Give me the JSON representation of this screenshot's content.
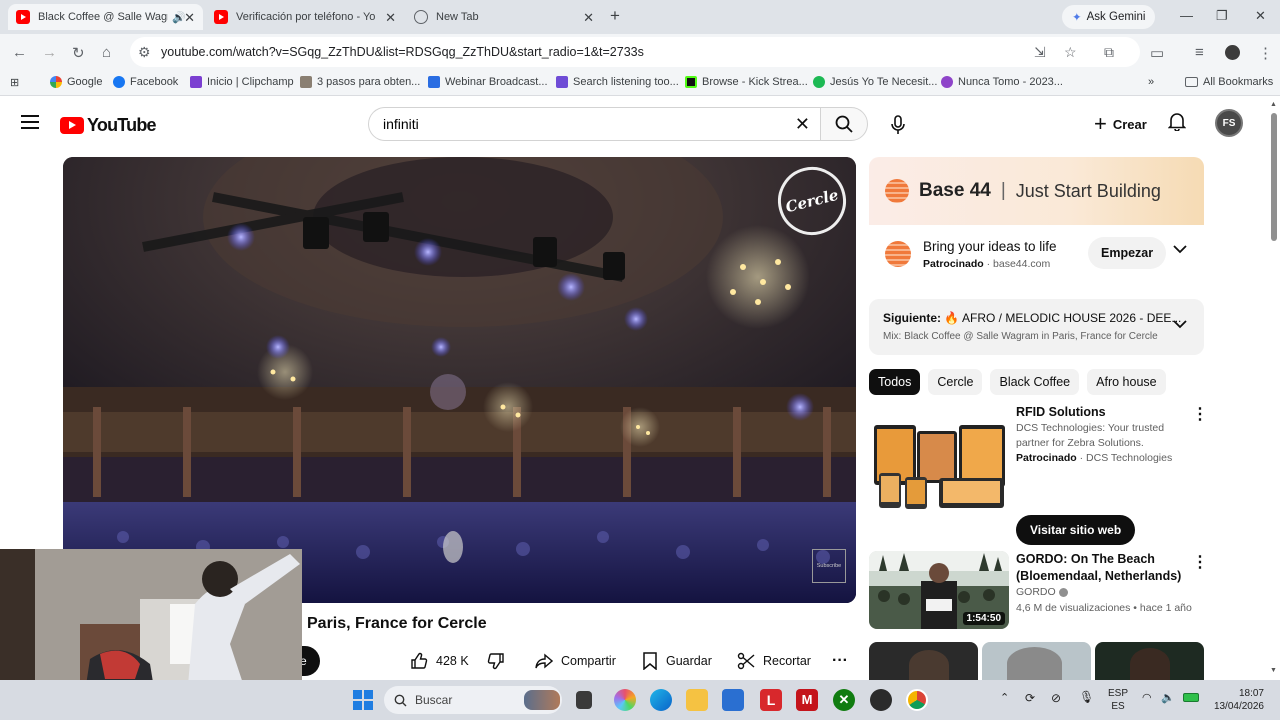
{
  "browser": {
    "tabs": [
      {
        "title": "Black Coffee @ Salle Wagram",
        "active": true
      },
      {
        "title": "Verificación por teléfono - YouTube",
        "active": false
      },
      {
        "title": "New Tab",
        "active": false
      }
    ],
    "ask_gemini": "Ask Gemini",
    "url": "youtube.com/watch?v=SGqg_ZzThDU&list=RDSGqg_ZzThDU&start_radio=1&t=2733s",
    "bookmarks": [
      "Google",
      "Facebook",
      "Inicio | Clipchamp",
      "3 pasos para obten...",
      "Webinar Broadcast...",
      "Search listening too...",
      "Browse - Kick Strea...",
      "Jesús Yo Te Necesit...",
      "Nunca Tomo - 2023..."
    ],
    "all_bookmarks": "All Bookmarks"
  },
  "youtube": {
    "logo": "YouTube",
    "search_value": "infiniti",
    "create_label": "Crear",
    "avatar_initials": "FS",
    "video": {
      "title": "Paris, France for Cercle",
      "watermark_logo": "Cercle",
      "watermark_sub": "Subscribe",
      "subscribe_fragment": "e",
      "likes": "428 K",
      "share": "Compartir",
      "save": "Guardar",
      "clip": "Recortar"
    },
    "ad": {
      "brand": "Base 44",
      "slogan": "Just Start Building",
      "headline": "Bring your ideas to life",
      "sponsored": "Patrocinado",
      "domain": "base44.com",
      "cta": "Empezar"
    },
    "up_next": {
      "label": "Siguiente:",
      "title": "AFRO / MELODIC HOUSE 2026 - DEE...",
      "mix": "Mix: Black Coffee @ Salle Wagram in Paris, France for Cercle"
    },
    "chips": [
      "Todos",
      "Cercle",
      "Black Coffee",
      "Afro house"
    ],
    "recommendations": [
      {
        "title": "RFID Solutions",
        "description": "DCS Technologies: Your trusted partner for Zebra Solutions.",
        "sponsored": "Patrocinado",
        "advertiser": "DCS Technologies",
        "cta": "Visitar sitio web"
      },
      {
        "title": "GORDO: On The Beach (Bloemendaal, Netherlands)",
        "channel": "GORDO",
        "stats": "4,6 M de visualizaciones • hace 1 año",
        "duration": "1:54:50"
      }
    ]
  },
  "taskbar": {
    "search_placeholder": "Buscar",
    "language": "ESP",
    "language_sub": "ES",
    "time": "18:07",
    "date": "13/04/2026"
  }
}
